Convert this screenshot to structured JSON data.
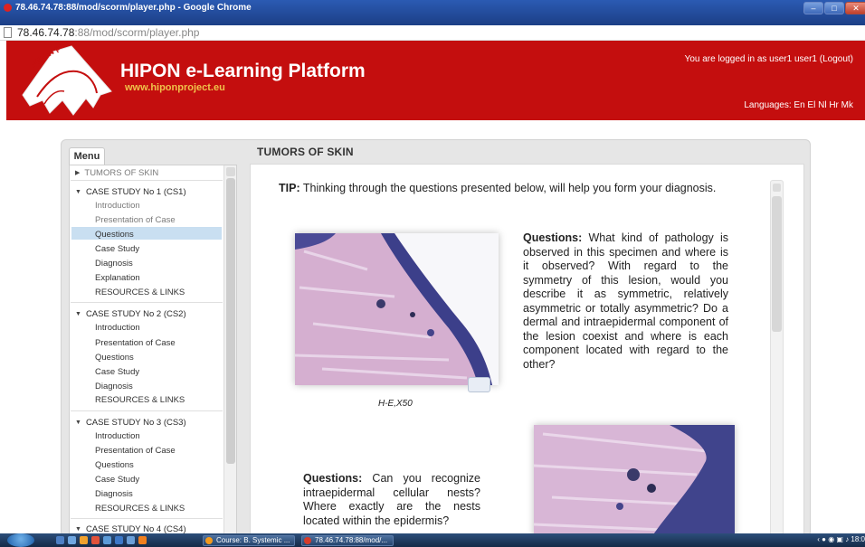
{
  "window": {
    "title": "78.46.74.78:88/mod/scorm/player.php - Google Chrome",
    "url_host": "78.46.74.78",
    "url_rest": ":88/mod/scorm/player.php"
  },
  "header": {
    "title": "HIPON e-Learning Platform",
    "url": "www.hiponproject.eu",
    "login_text": "You are logged in as user1 user1 (Logout)",
    "languages_text": "Languages: En El Nl Hr Mk",
    "logo_text": "HIPON project"
  },
  "menu": {
    "tab_label": "Menu",
    "top_item": "TUMORS OF SKIN",
    "cases": [
      {
        "label": "CASE STUDY No 1 (CS1)",
        "items": [
          "Introduction",
          "Presentation of Case",
          "Questions",
          "Case Study",
          "Diagnosis",
          "Explanation",
          "RESOURCES & LINKS"
        ]
      },
      {
        "label": "CASE STUDY No 2 (CS2)",
        "items": [
          "Introduction",
          "Presentation of Case",
          "Questions",
          "Case Study",
          "Diagnosis",
          "RESOURCES & LINKS"
        ]
      },
      {
        "label": "CASE STUDY No 3 (CS3)",
        "items": [
          "Introduction",
          "Presentation of Case",
          "Questions",
          "Case Study",
          "Diagnosis",
          "RESOURCES & LINKS"
        ]
      },
      {
        "label": "CASE STUDY No 4 (CS4)"
      }
    ],
    "selected": "Questions"
  },
  "content": {
    "section_title": "TUMORS OF SKIN",
    "tip_label": "TIP:",
    "tip_text": " Thinking through the questions presented below, will help you form your diagnosis.",
    "image1_caption": "H-E,X50",
    "q1_label": "Questions:",
    "q1_text": " What kind of pathology is observed in this specimen and where is it observed? With regard to the symmetry of this lesion, would you describe it as symmetric, relatively asymmetric or totally asymmetric? Do a dermal and intraepidermal component of the lesion coexist and where is each component located with regard to the other?",
    "q2_label": "Questions:",
    "q2_text": " Can you recognize intraepidermal cellular nests? Where exactly are the nests located within the epidermis?"
  },
  "taskbar": {
    "task1": "Course: B. Systemic ...",
    "task2": "78.46.74.78:88/mod/...",
    "clock": "18:0"
  },
  "colors": {
    "header_red": "#c40e0e",
    "brand_url_gold": "#f0c24a",
    "menu_highlight": "#c9dff1"
  }
}
